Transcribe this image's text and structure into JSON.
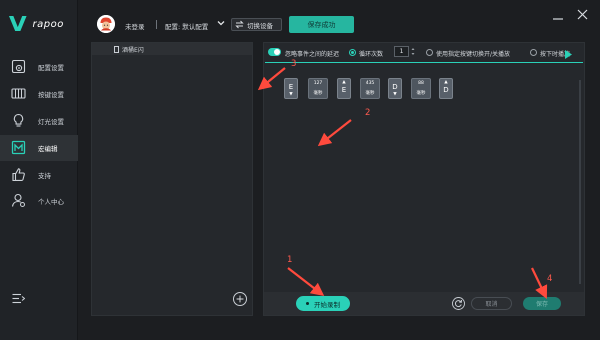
{
  "brand": {
    "mark": "V",
    "word": "rapoo"
  },
  "colors": {
    "accent": "#2ad1b8",
    "annotation": "#ff4a3d",
    "background": "#1c1e21"
  },
  "sidebar": {
    "items": [
      {
        "label": "配置设置",
        "icon": "settings-doc-icon"
      },
      {
        "label": "按键设置",
        "icon": "keyboard-icon"
      },
      {
        "label": "灯光设置",
        "icon": "lightbulb-icon"
      },
      {
        "label": "宏编辑",
        "icon": "macro-icon",
        "active": true
      },
      {
        "label": "支持",
        "icon": "thumbs-up-icon"
      },
      {
        "label": "个人中心",
        "icon": "user-icon"
      }
    ]
  },
  "header": {
    "login_status": "未登录",
    "config_label": "配置: 默认配置",
    "switch_device": "切换设备",
    "save_status": "保存成功"
  },
  "macro_list": {
    "items": [
      {
        "name": "酒桶E闪"
      }
    ]
  },
  "options": {
    "ignore_delay": "忽略事件之间的延迟",
    "loop_count_label": "循环次数",
    "loop_count_value": "1",
    "toggle_mode": "使用指定按键切换开/关播放",
    "hold_mode": "按下时播放"
  },
  "macro_steps": [
    {
      "type": "key",
      "key": "E",
      "dir": "down"
    },
    {
      "type": "delay",
      "value": "127",
      "unit": "毫秒"
    },
    {
      "type": "key",
      "key": "E",
      "dir": "up"
    },
    {
      "type": "delay",
      "value": "435",
      "unit": "毫秒"
    },
    {
      "type": "key",
      "key": "D",
      "dir": "down"
    },
    {
      "type": "delay",
      "value": "88",
      "unit": "毫秒"
    },
    {
      "type": "key",
      "key": "D",
      "dir": "up"
    }
  ],
  "bottom": {
    "record": "开始录制",
    "cancel": "取消",
    "save": "保存"
  },
  "annotations": [
    "1",
    "2",
    "3",
    "4"
  ]
}
